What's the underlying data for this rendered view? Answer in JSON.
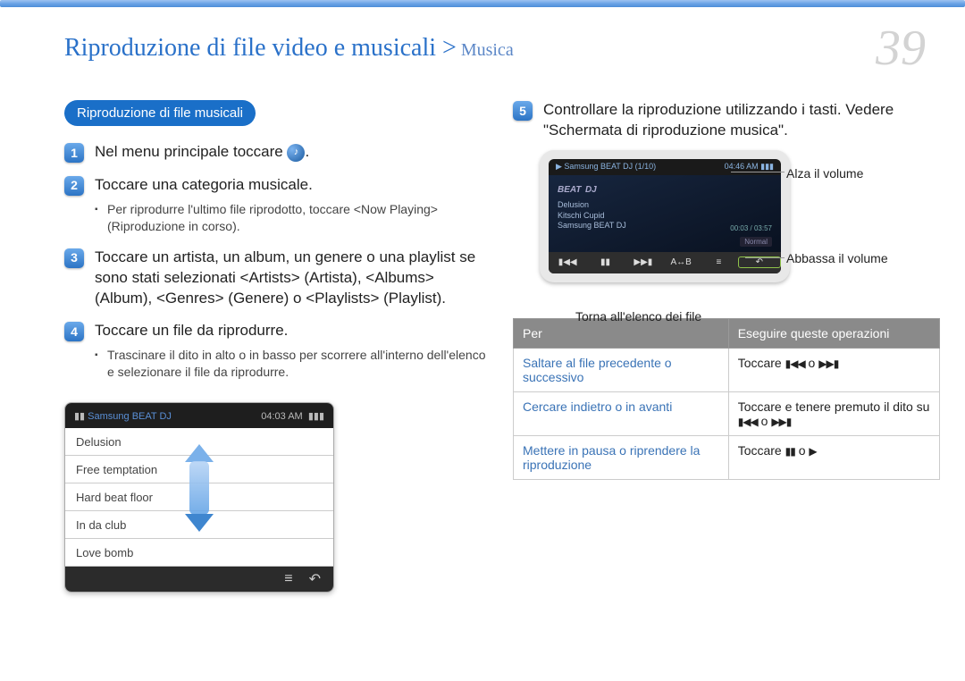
{
  "header": {
    "title_main": "Riproduzione di file video e musicali >",
    "title_sub": " Musica",
    "page_number": "39"
  },
  "pill": "Riproduzione di file musicali",
  "steps": {
    "s1": "Nel menu principale toccare ",
    "s2": "Toccare una categoria musicale.",
    "s2_note": "Per riprodurre l'ultimo file riprodotto, toccare <Now Playing> (Riproduzione in corso).",
    "s3": "Toccare un artista, un album, un genere o una playlist se sono stati selezionati <Artists> (Artista), <Albums> (Album), <Genres> (Genere) o <Playlists> (Playlist).",
    "s4": "Toccare un file da riprodurre.",
    "s4_note": "Trascinare il dito in alto o in basso per scorrere all'interno dell'elenco e selezionare il file da riprodurre."
  },
  "device_list": {
    "status_name": "Samsung BEAT DJ",
    "status_time": "04:03 AM",
    "tracks": [
      "Delusion",
      "Free temptation",
      "Hard beat floor",
      "In da club",
      "Love bomb"
    ]
  },
  "right_step": {
    "num": "5",
    "text": "Controllare la riproduzione utilizzando i tasti. Vedere \"Schermata di riproduzione musica\"."
  },
  "player": {
    "top_name": "Samsung BEAT DJ",
    "top_counter": "(1/10)",
    "top_time": "04:46 AM",
    "brand": "BEAT",
    "brand_sub": "DJ",
    "track_title": "Delusion",
    "track_artist": "Kitschi Cupid",
    "track_album": "Samsung BEAT DJ",
    "mode": "Normal",
    "timer": "00:03 / 03:57"
  },
  "callouts": {
    "volume_up": "Alza il volume",
    "volume_down": "Abbassa il volume",
    "back_list": "Torna all'elenco dei file"
  },
  "table": {
    "head_left": "Per",
    "head_right": "Eseguire queste operazioni",
    "r1_left": "Saltare al file precedente o successivo",
    "r1_right_a": "Toccare ",
    "r1_right_b": " o ",
    "r2_left": "Cercare indietro o in avanti",
    "r2_right_a": "Toccare e tenere premuto il dito su ",
    "r2_right_b": " o ",
    "r3_left": "Mettere in pausa o riprendere la riproduzione",
    "r3_right_a": "Toccare ",
    "r3_right_b": " o "
  }
}
